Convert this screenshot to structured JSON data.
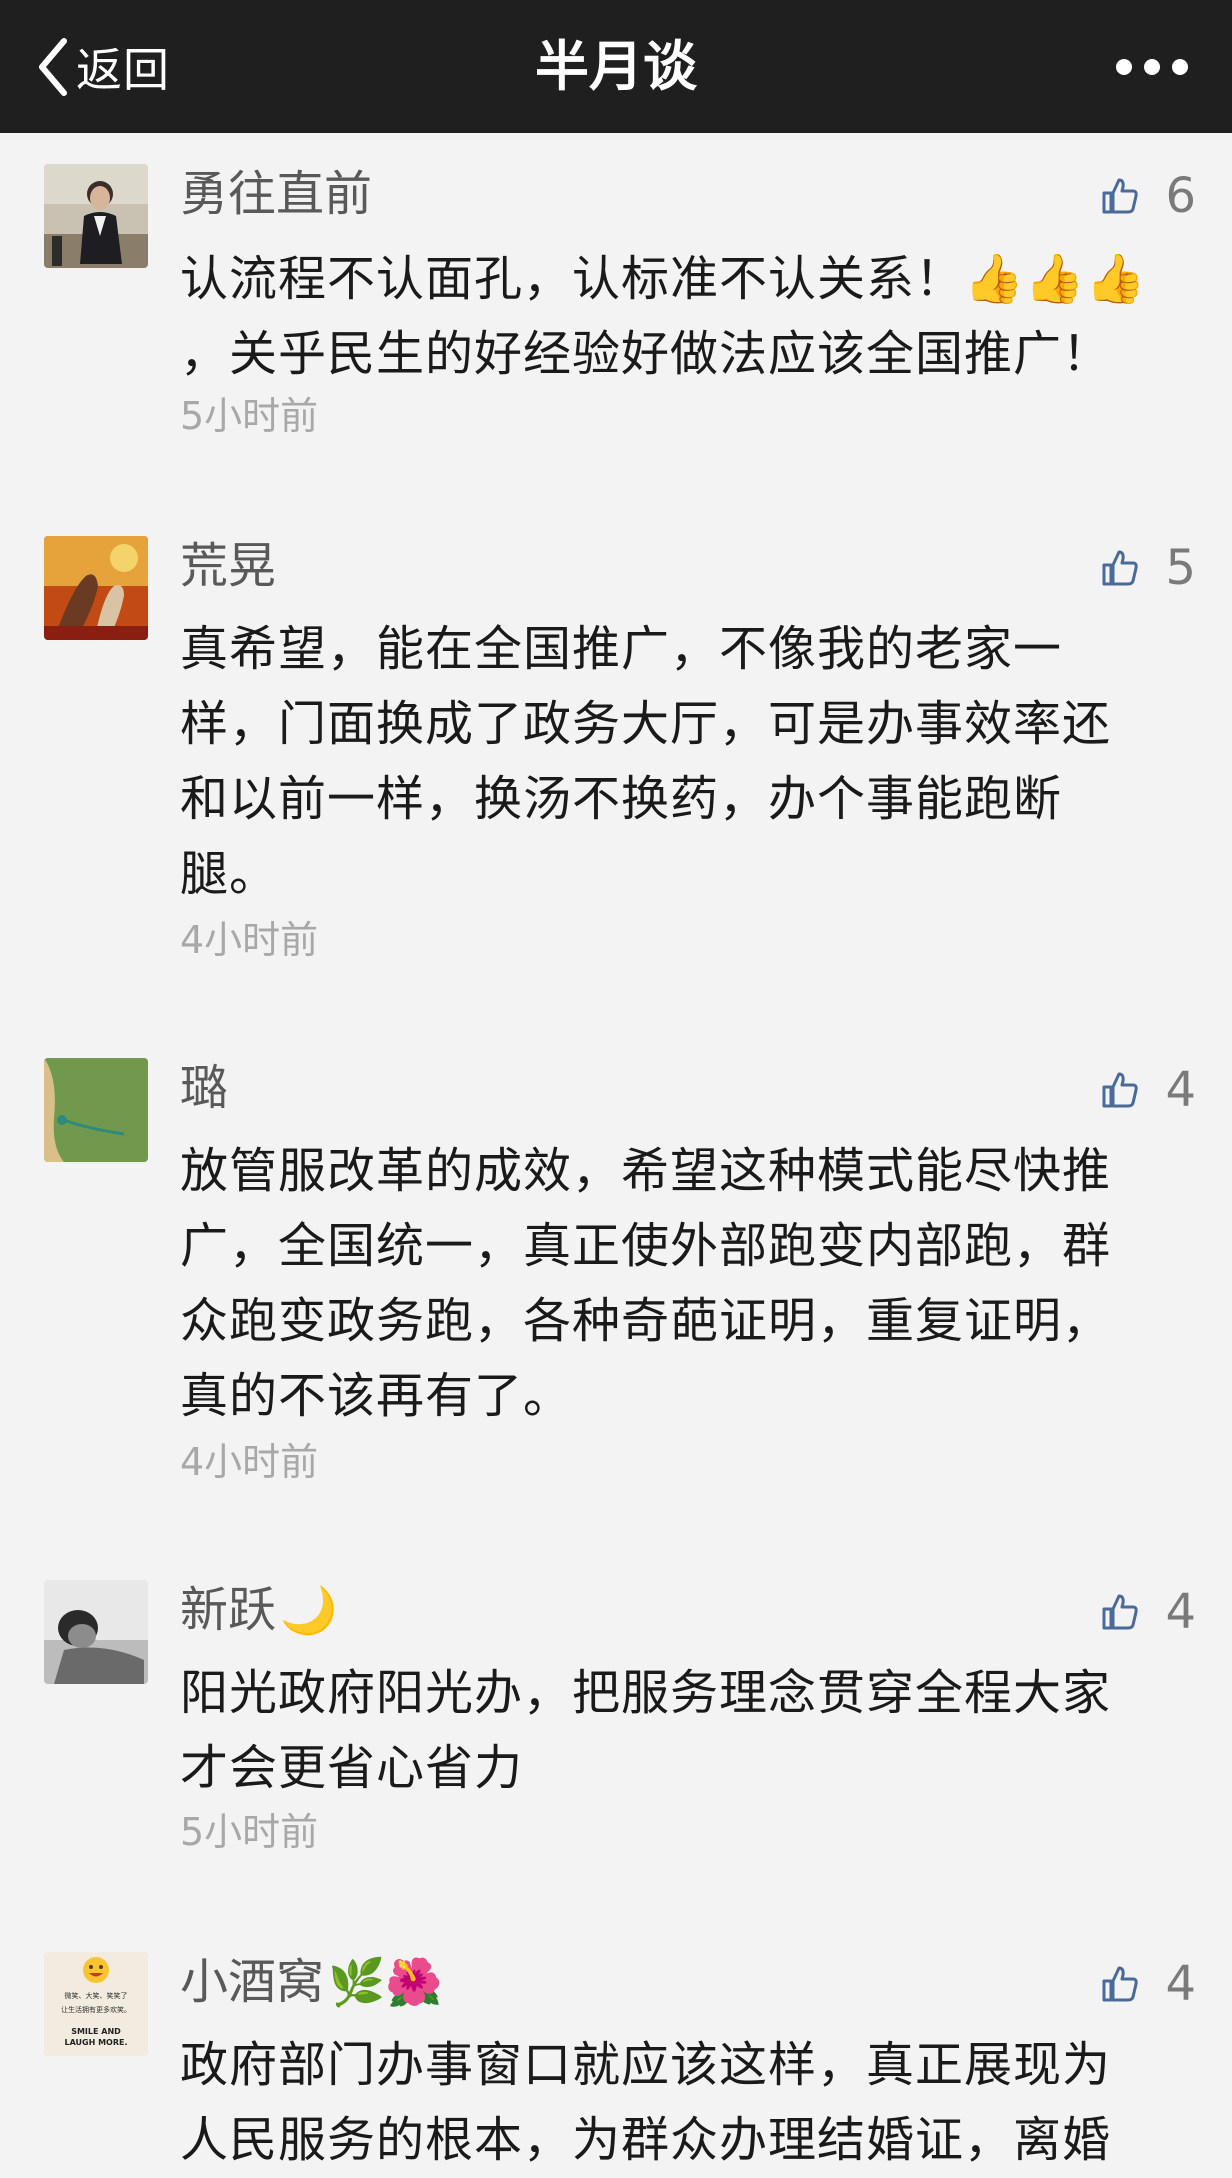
{
  "header": {
    "back_label": "返回",
    "title": "半月谈"
  },
  "comments": [
    {
      "nickname": "勇往直前",
      "likes": "6",
      "content": "认流程不认面孔，认标准不认关系！👍👍👍\n，关乎民生的好经验好做法应该全国推广！",
      "time": "5小时前"
    },
    {
      "nickname": "荒晃",
      "likes": "5",
      "content": "真希望，能在全国推广，不像我的老家一\n样，门面换成了政务大厅，可是办事效率还\n和以前一样，换汤不换药，办个事能跑断\n腿。",
      "time": "4小时前"
    },
    {
      "nickname": "璐",
      "likes": "4",
      "content": "放管服改革的成效，希望这种模式能尽快推\n广，全国统一，真正使外部跑变内部跑，群\n众跑变政务跑，各种奇葩证明，重复证明，\n真的不该再有了。",
      "time": "4小时前"
    },
    {
      "nickname": "新跃",
      "nickname_emoji": "🌙",
      "likes": "4",
      "content": "阳光政府阳光办，把服务理念贯穿全程大家\n才会更省心省力",
      "time": "5小时前"
    },
    {
      "nickname": "小酒窝",
      "nickname_emoji": "🌿🌺",
      "likes": "4",
      "content": "政府部门办事窗口就应该这样，真正展现为\n人民服务的根本，为群众办理结婚证，离婚",
      "avatar_text": {
        "line1": "微笑、大笑、笑笑了",
        "line2": "让生活拥有更多欢笑。",
        "line3": "SMILE AND",
        "line4": "LAUGH MORE."
      }
    }
  ],
  "colors": {
    "header_bg": "#1f1f1f",
    "page_bg": "#f3f3f3",
    "like_icon": "#4a6a9a",
    "meta_text": "#a8a8a8"
  }
}
